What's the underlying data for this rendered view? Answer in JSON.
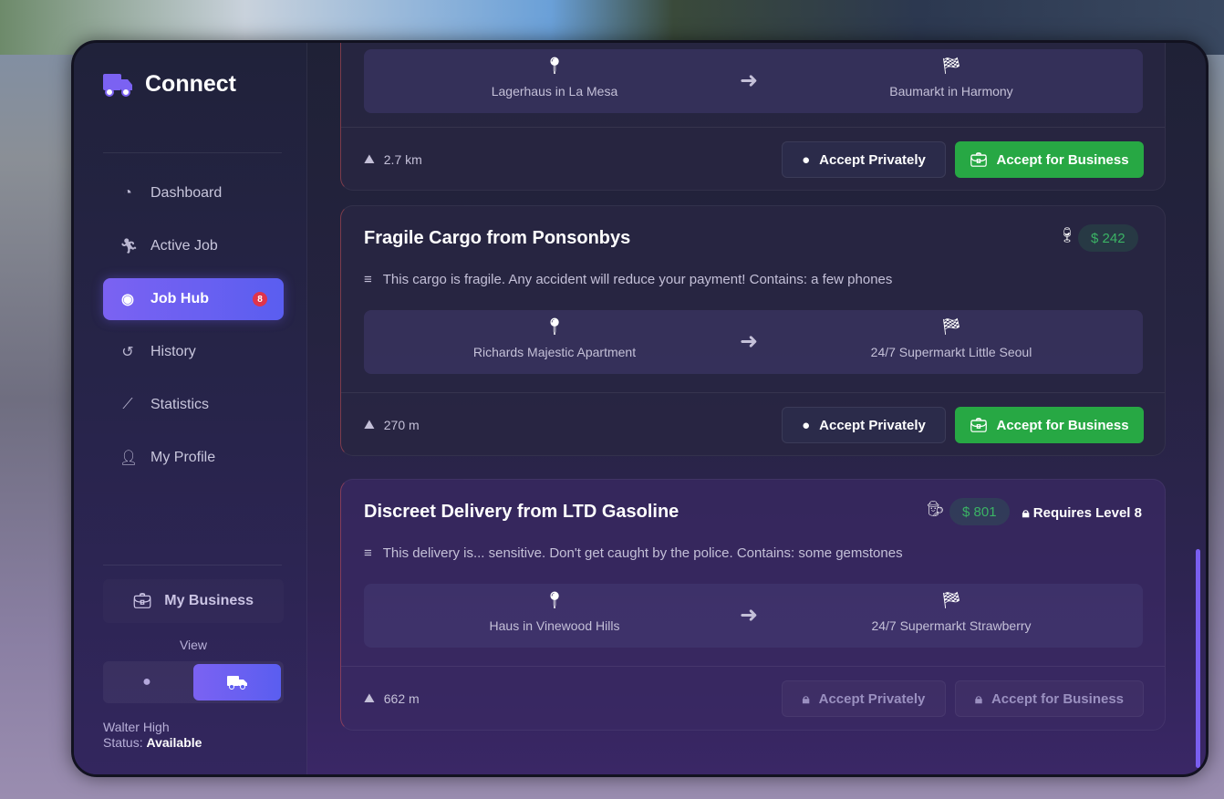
{
  "app": {
    "title": "Connect",
    "logo_icon": "truck-icon"
  },
  "nav": [
    {
      "label": "Dashboard",
      "icon": "gauge-icon"
    },
    {
      "label": "Active Job",
      "icon": "running-icon"
    },
    {
      "label": "Job Hub",
      "icon": "compass-icon",
      "badge": "8",
      "active": true
    },
    {
      "label": "History",
      "icon": "history-icon"
    },
    {
      "label": "Statistics",
      "icon": "chart-line-icon"
    },
    {
      "label": "My Profile",
      "icon": "user-cog-icon"
    }
  ],
  "business": {
    "label": "My Business"
  },
  "view": {
    "label": "View",
    "options": [
      "person",
      "truck"
    ],
    "selected": "truck"
  },
  "user": {
    "name": "Walter High",
    "status_label": "Status:",
    "status": "Available"
  },
  "jobs": [
    {
      "from": "Lagerhaus in La Mesa",
      "to": "Baumarkt in Harmony",
      "distance": "2.7 km",
      "accept_private": "Accept Privately",
      "accept_business": "Accept for Business"
    },
    {
      "title": "Fragile Cargo from Ponsonbys",
      "type_icon": "wine-glass-icon",
      "pay": "$ 242",
      "description": "This cargo is fragile. Any accident will reduce your payment! Contains: a few phones",
      "from": "Richards Majestic Apartment",
      "to": "24/7 Supermarkt Little Seoul",
      "distance": "270 m",
      "accept_private": "Accept Privately",
      "accept_business": "Accept for Business"
    },
    {
      "title": "Discreet Delivery from LTD Gasoline",
      "type_icon": "user-secret-icon",
      "pay": "$ 801",
      "requirement": "Requires Level 8",
      "description": "This delivery is... sensitive. Don't get caught by the police. Contains: some gemstones",
      "from": "Haus in Vinewood Hills",
      "to": "24/7 Supermarkt Strawberry",
      "distance": "662 m",
      "accept_private": "Accept Privately",
      "accept_business": "Accept for Business",
      "locked": true
    }
  ],
  "colors": {
    "accent": "#6b5ff2",
    "success": "#27a844",
    "badge": "#e0344b"
  }
}
